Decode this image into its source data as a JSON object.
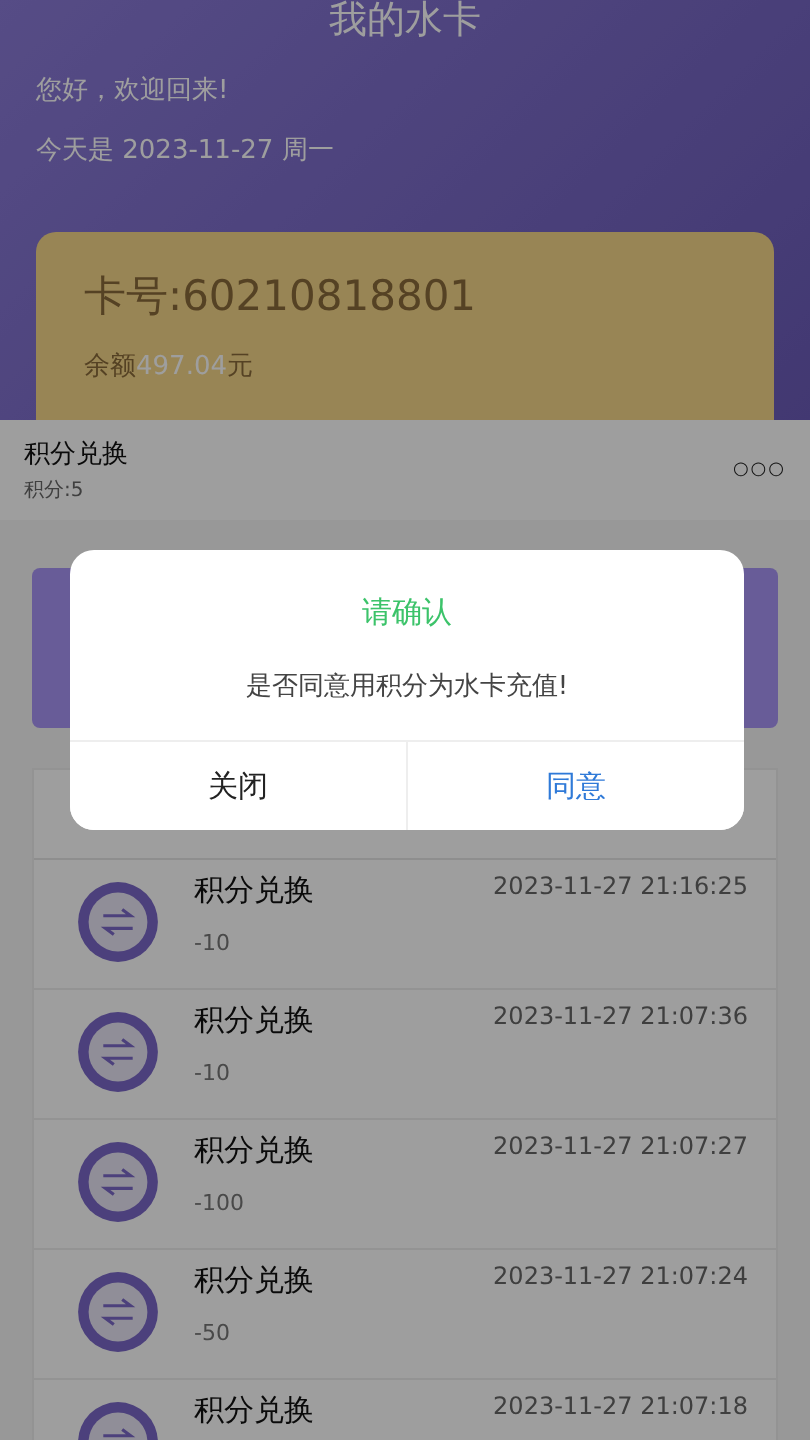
{
  "header": {
    "title": "我的水卡",
    "greeting": "您好，欢迎回来!",
    "date_line": "今天是 2023-11-27 周一"
  },
  "card": {
    "number": "卡号:60210818801",
    "balance_label": "余额",
    "balance_value": "497.04",
    "balance_unit": "元"
  },
  "sheet": {
    "title": "积分兑换",
    "points": "积分:5",
    "more": "○○○"
  },
  "records": [
    {
      "title": "积分兑换",
      "amount": "-10",
      "time": "2023-11-27 21:16:25"
    },
    {
      "title": "积分兑换",
      "amount": "-10",
      "time": "2023-11-27 21:07:36"
    },
    {
      "title": "积分兑换",
      "amount": "-100",
      "time": "2023-11-27 21:07:27"
    },
    {
      "title": "积分兑换",
      "amount": "-50",
      "time": "2023-11-27 21:07:24"
    },
    {
      "title": "积分兑换",
      "time": "2023-11-27 21:07:18"
    }
  ],
  "dialog": {
    "title": "请确认",
    "message": "是否同意用积分为水卡充值!",
    "buttons": [
      {
        "label": "关闭",
        "kind": "cancel"
      },
      {
        "label": "同意",
        "kind": "confirm"
      }
    ]
  }
}
